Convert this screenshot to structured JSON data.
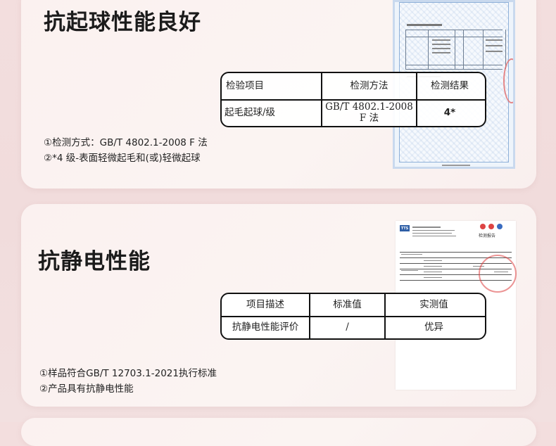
{
  "section1": {
    "title": "抗起球性能良好",
    "table": {
      "headers": [
        "检验项目",
        "检测方法",
        "检测结果"
      ],
      "row": {
        "item": "起毛起球/级",
        "method_line1": "GB/T 4802.1-2008",
        "method_line2": "F 法",
        "result": "4*"
      }
    },
    "notes": [
      "①检测方式：GB/T 4802.1-2008 F 法",
      "②*4 级-表面轻微起毛和(或)轻微起球"
    ]
  },
  "section2": {
    "title": "抗静电性能",
    "table": {
      "headers": [
        "项目描述",
        "标准值",
        "实测值"
      ],
      "row": {
        "item": "抗静电性能评价",
        "standard": "/",
        "measured": "优异"
      }
    },
    "notes": [
      "①样品符合GB/T 12703.1-2021执行标准",
      "②产品具有抗静电性能"
    ],
    "report": {
      "logo": "TTS",
      "heading": "检测报告"
    }
  }
}
